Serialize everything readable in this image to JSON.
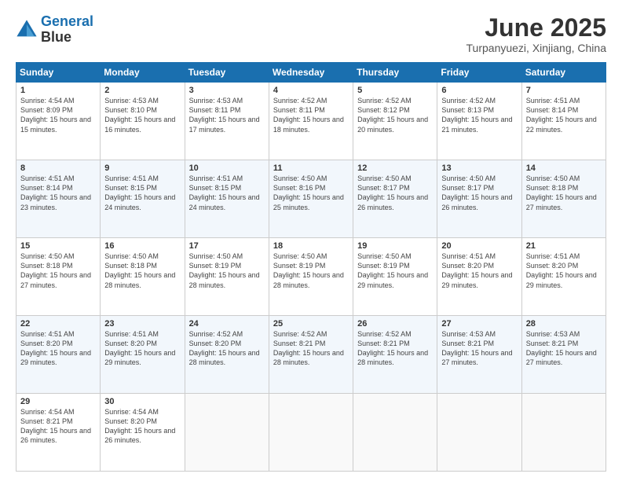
{
  "logo": {
    "line1": "General",
    "line2": "Blue"
  },
  "title": "June 2025",
  "subtitle": "Turpanyuezi, Xinjiang, China",
  "headers": [
    "Sunday",
    "Monday",
    "Tuesday",
    "Wednesday",
    "Thursday",
    "Friday",
    "Saturday"
  ],
  "weeks": [
    [
      {
        "day": "1",
        "sunrise": "4:54 AM",
        "sunset": "8:09 PM",
        "daylight": "15 hours and 15 minutes."
      },
      {
        "day": "2",
        "sunrise": "4:53 AM",
        "sunset": "8:10 PM",
        "daylight": "15 hours and 16 minutes."
      },
      {
        "day": "3",
        "sunrise": "4:53 AM",
        "sunset": "8:11 PM",
        "daylight": "15 hours and 17 minutes."
      },
      {
        "day": "4",
        "sunrise": "4:52 AM",
        "sunset": "8:11 PM",
        "daylight": "15 hours and 18 minutes."
      },
      {
        "day": "5",
        "sunrise": "4:52 AM",
        "sunset": "8:12 PM",
        "daylight": "15 hours and 20 minutes."
      },
      {
        "day": "6",
        "sunrise": "4:52 AM",
        "sunset": "8:13 PM",
        "daylight": "15 hours and 21 minutes."
      },
      {
        "day": "7",
        "sunrise": "4:51 AM",
        "sunset": "8:14 PM",
        "daylight": "15 hours and 22 minutes."
      }
    ],
    [
      {
        "day": "8",
        "sunrise": "4:51 AM",
        "sunset": "8:14 PM",
        "daylight": "15 hours and 23 minutes."
      },
      {
        "day": "9",
        "sunrise": "4:51 AM",
        "sunset": "8:15 PM",
        "daylight": "15 hours and 24 minutes."
      },
      {
        "day": "10",
        "sunrise": "4:51 AM",
        "sunset": "8:15 PM",
        "daylight": "15 hours and 24 minutes."
      },
      {
        "day": "11",
        "sunrise": "4:50 AM",
        "sunset": "8:16 PM",
        "daylight": "15 hours and 25 minutes."
      },
      {
        "day": "12",
        "sunrise": "4:50 AM",
        "sunset": "8:17 PM",
        "daylight": "15 hours and 26 minutes."
      },
      {
        "day": "13",
        "sunrise": "4:50 AM",
        "sunset": "8:17 PM",
        "daylight": "15 hours and 26 minutes."
      },
      {
        "day": "14",
        "sunrise": "4:50 AM",
        "sunset": "8:18 PM",
        "daylight": "15 hours and 27 minutes."
      }
    ],
    [
      {
        "day": "15",
        "sunrise": "4:50 AM",
        "sunset": "8:18 PM",
        "daylight": "15 hours and 27 minutes."
      },
      {
        "day": "16",
        "sunrise": "4:50 AM",
        "sunset": "8:18 PM",
        "daylight": "15 hours and 28 minutes."
      },
      {
        "day": "17",
        "sunrise": "4:50 AM",
        "sunset": "8:19 PM",
        "daylight": "15 hours and 28 minutes."
      },
      {
        "day": "18",
        "sunrise": "4:50 AM",
        "sunset": "8:19 PM",
        "daylight": "15 hours and 28 minutes."
      },
      {
        "day": "19",
        "sunrise": "4:50 AM",
        "sunset": "8:19 PM",
        "daylight": "15 hours and 29 minutes."
      },
      {
        "day": "20",
        "sunrise": "4:51 AM",
        "sunset": "8:20 PM",
        "daylight": "15 hours and 29 minutes."
      },
      {
        "day": "21",
        "sunrise": "4:51 AM",
        "sunset": "8:20 PM",
        "daylight": "15 hours and 29 minutes."
      }
    ],
    [
      {
        "day": "22",
        "sunrise": "4:51 AM",
        "sunset": "8:20 PM",
        "daylight": "15 hours and 29 minutes."
      },
      {
        "day": "23",
        "sunrise": "4:51 AM",
        "sunset": "8:20 PM",
        "daylight": "15 hours and 29 minutes."
      },
      {
        "day": "24",
        "sunrise": "4:52 AM",
        "sunset": "8:20 PM",
        "daylight": "15 hours and 28 minutes."
      },
      {
        "day": "25",
        "sunrise": "4:52 AM",
        "sunset": "8:21 PM",
        "daylight": "15 hours and 28 minutes."
      },
      {
        "day": "26",
        "sunrise": "4:52 AM",
        "sunset": "8:21 PM",
        "daylight": "15 hours and 28 minutes."
      },
      {
        "day": "27",
        "sunrise": "4:53 AM",
        "sunset": "8:21 PM",
        "daylight": "15 hours and 27 minutes."
      },
      {
        "day": "28",
        "sunrise": "4:53 AM",
        "sunset": "8:21 PM",
        "daylight": "15 hours and 27 minutes."
      }
    ],
    [
      {
        "day": "29",
        "sunrise": "4:54 AM",
        "sunset": "8:21 PM",
        "daylight": "15 hours and 26 minutes."
      },
      {
        "day": "30",
        "sunrise": "4:54 AM",
        "sunset": "8:20 PM",
        "daylight": "15 hours and 26 minutes."
      },
      null,
      null,
      null,
      null,
      null
    ]
  ]
}
